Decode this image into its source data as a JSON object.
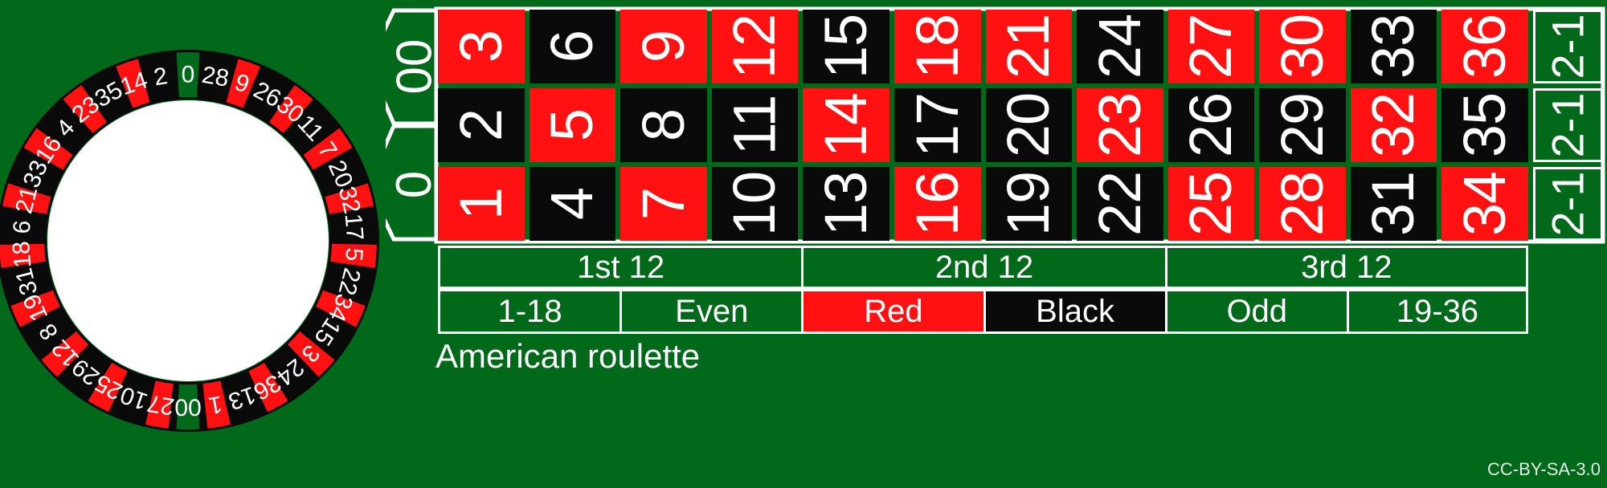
{
  "caption": "American roulette",
  "license": "CC-BY-SA-3.0",
  "colors": {
    "felt_green": "#00691a",
    "red": "#ff1111",
    "black": "#0a0a0a",
    "line_white": "#ffffff",
    "wheel_hub": "#ffffff"
  },
  "wheel": {
    "name": "american-roulette-wheel",
    "pocket_count": 38,
    "pockets": [
      {
        "label": "0",
        "color": "green"
      },
      {
        "label": "28",
        "color": "black"
      },
      {
        "label": "9",
        "color": "red"
      },
      {
        "label": "26",
        "color": "black"
      },
      {
        "label": "30",
        "color": "red"
      },
      {
        "label": "11",
        "color": "black"
      },
      {
        "label": "7",
        "color": "red"
      },
      {
        "label": "20",
        "color": "black"
      },
      {
        "label": "32",
        "color": "red"
      },
      {
        "label": "17",
        "color": "black"
      },
      {
        "label": "5",
        "color": "red"
      },
      {
        "label": "22",
        "color": "black"
      },
      {
        "label": "34",
        "color": "red"
      },
      {
        "label": "15",
        "color": "black"
      },
      {
        "label": "3",
        "color": "red"
      },
      {
        "label": "24",
        "color": "black"
      },
      {
        "label": "36",
        "color": "red"
      },
      {
        "label": "13",
        "color": "black"
      },
      {
        "label": "1",
        "color": "red"
      },
      {
        "label": "00",
        "color": "green"
      },
      {
        "label": "27",
        "color": "red"
      },
      {
        "label": "10",
        "color": "black"
      },
      {
        "label": "25",
        "color": "red"
      },
      {
        "label": "29",
        "color": "black"
      },
      {
        "label": "12",
        "color": "red"
      },
      {
        "label": "8",
        "color": "black"
      },
      {
        "label": "19",
        "color": "red"
      },
      {
        "label": "31",
        "color": "black"
      },
      {
        "label": "18",
        "color": "red"
      },
      {
        "label": "6",
        "color": "black"
      },
      {
        "label": "21",
        "color": "red"
      },
      {
        "label": "33",
        "color": "black"
      },
      {
        "label": "16",
        "color": "red"
      },
      {
        "label": "4",
        "color": "black"
      },
      {
        "label": "23",
        "color": "red"
      },
      {
        "label": "35",
        "color": "black"
      },
      {
        "label": "14",
        "color": "red"
      },
      {
        "label": "2",
        "color": "black"
      }
    ]
  },
  "layout": {
    "zero_cells": [
      {
        "label": "00",
        "color": "green"
      },
      {
        "label": "0",
        "color": "green"
      }
    ],
    "number_rows": [
      [
        {
          "label": "3",
          "color": "red"
        },
        {
          "label": "6",
          "color": "black"
        },
        {
          "label": "9",
          "color": "red"
        },
        {
          "label": "12",
          "color": "red"
        },
        {
          "label": "15",
          "color": "black"
        },
        {
          "label": "18",
          "color": "red"
        },
        {
          "label": "21",
          "color": "red"
        },
        {
          "label": "24",
          "color": "black"
        },
        {
          "label": "27",
          "color": "red"
        },
        {
          "label": "30",
          "color": "red"
        },
        {
          "label": "33",
          "color": "black"
        },
        {
          "label": "36",
          "color": "red"
        }
      ],
      [
        {
          "label": "2",
          "color": "black"
        },
        {
          "label": "5",
          "color": "red"
        },
        {
          "label": "8",
          "color": "black"
        },
        {
          "label": "11",
          "color": "black"
        },
        {
          "label": "14",
          "color": "red"
        },
        {
          "label": "17",
          "color": "black"
        },
        {
          "label": "20",
          "color": "black"
        },
        {
          "label": "23",
          "color": "red"
        },
        {
          "label": "26",
          "color": "black"
        },
        {
          "label": "29",
          "color": "black"
        },
        {
          "label": "32",
          "color": "red"
        },
        {
          "label": "35",
          "color": "black"
        }
      ],
      [
        {
          "label": "1",
          "color": "red"
        },
        {
          "label": "4",
          "color": "black"
        },
        {
          "label": "7",
          "color": "red"
        },
        {
          "label": "10",
          "color": "black"
        },
        {
          "label": "13",
          "color": "black"
        },
        {
          "label": "16",
          "color": "red"
        },
        {
          "label": "19",
          "color": "black"
        },
        {
          "label": "22",
          "color": "black"
        },
        {
          "label": "25",
          "color": "red"
        },
        {
          "label": "28",
          "color": "red"
        },
        {
          "label": "31",
          "color": "black"
        },
        {
          "label": "34",
          "color": "red"
        }
      ]
    ],
    "column_bets": [
      {
        "label": "2-1"
      },
      {
        "label": "2-1"
      },
      {
        "label": "2-1"
      }
    ],
    "dozens": [
      {
        "label": "1st 12"
      },
      {
        "label": "2nd 12"
      },
      {
        "label": "3rd 12"
      }
    ],
    "outside_bets": [
      {
        "label": "1-18",
        "style": "green"
      },
      {
        "label": "Even",
        "style": "green"
      },
      {
        "label": "Red",
        "style": "red"
      },
      {
        "label": "Black",
        "style": "black"
      },
      {
        "label": "Odd",
        "style": "green"
      },
      {
        "label": "19-36",
        "style": "green"
      }
    ]
  }
}
